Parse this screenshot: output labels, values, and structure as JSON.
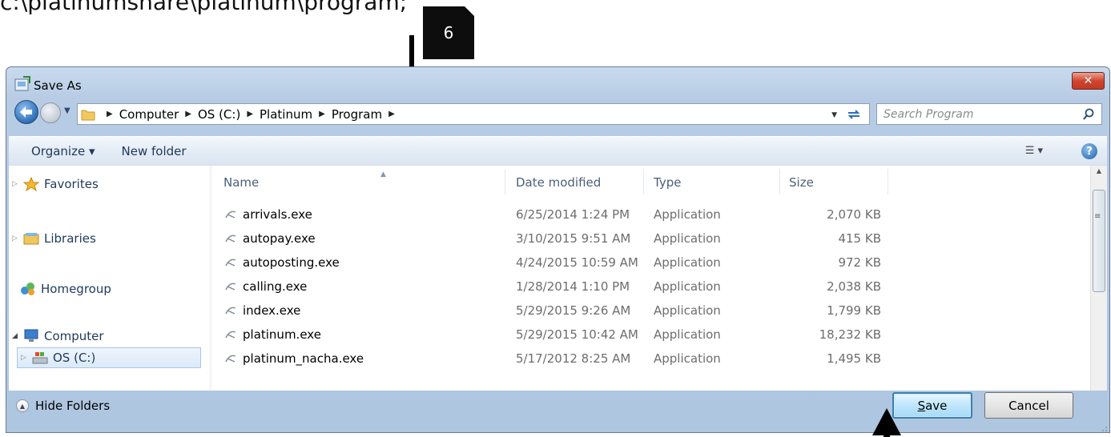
{
  "caption": "c:\\platinumshare\\platinum\\program;",
  "step_number": "6",
  "window": {
    "title": "Save As",
    "close_symbol": "✕"
  },
  "address": {
    "breadcrumbs": [
      "Computer",
      "OS (C:)",
      "Platinum",
      "Program"
    ],
    "search_placeholder": "Search Program"
  },
  "toolbar": {
    "organize": "Organize ▾",
    "new_folder": "New folder",
    "help": "?"
  },
  "nav": {
    "favorites": "Favorites",
    "libraries": "Libraries",
    "homegroup": "Homegroup",
    "computer": "Computer",
    "os_drive": "OS (C:)"
  },
  "columns": {
    "name": "Name",
    "date": "Date modified",
    "type": "Type",
    "size": "Size"
  },
  "files": [
    {
      "name": "arrivals.exe",
      "date": "6/25/2014 1:24 PM",
      "type": "Application",
      "size": "2,070 KB"
    },
    {
      "name": "autopay.exe",
      "date": "3/10/2015 9:51 AM",
      "type": "Application",
      "size": "415 KB"
    },
    {
      "name": "autoposting.exe",
      "date": "4/24/2015 10:59 AM",
      "type": "Application",
      "size": "972 KB"
    },
    {
      "name": "calling.exe",
      "date": "1/28/2014 1:10 PM",
      "type": "Application",
      "size": "2,038 KB"
    },
    {
      "name": "index.exe",
      "date": "5/29/2015 9:26 AM",
      "type": "Application",
      "size": "1,799 KB"
    },
    {
      "name": "platinum.exe",
      "date": "5/29/2015 10:42 AM",
      "type": "Application",
      "size": "18,232 KB"
    },
    {
      "name": "platinum_nacha.exe",
      "date": "5/17/2012 8:25 AM",
      "type": "Application",
      "size": "1,495 KB"
    }
  ],
  "footer": {
    "hide_folders": "Hide Folders",
    "save_rest": "ave",
    "save_mnemonic": "S",
    "cancel": "Cancel"
  },
  "colors": {
    "accent": "#3c7fb1",
    "title_bar": "#c8daee",
    "close": "#d1452e"
  }
}
